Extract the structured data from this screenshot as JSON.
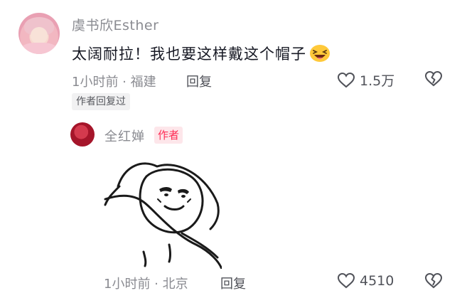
{
  "comment": {
    "username": "虞书欣Esther",
    "text": "太阔耐拉！我也要这样戴这个帽子",
    "emoji_icon": "grinning-squinting-face-icon",
    "time_location": "1小时前 · 福建",
    "reply_label": "回复",
    "like_count": "1.5万",
    "author_replied_tag": "作者回复过"
  },
  "reply": {
    "username": "全红婵",
    "author_badge": "作者",
    "sticker_icon": "cartoon-sticker-lying-face",
    "time_location": "1小时前 · 北京",
    "reply_label": "回复",
    "like_count": "4510"
  },
  "colors": {
    "accent": "#fe2c55",
    "muted_text": "#8a8b91",
    "primary_text": "#161823"
  }
}
